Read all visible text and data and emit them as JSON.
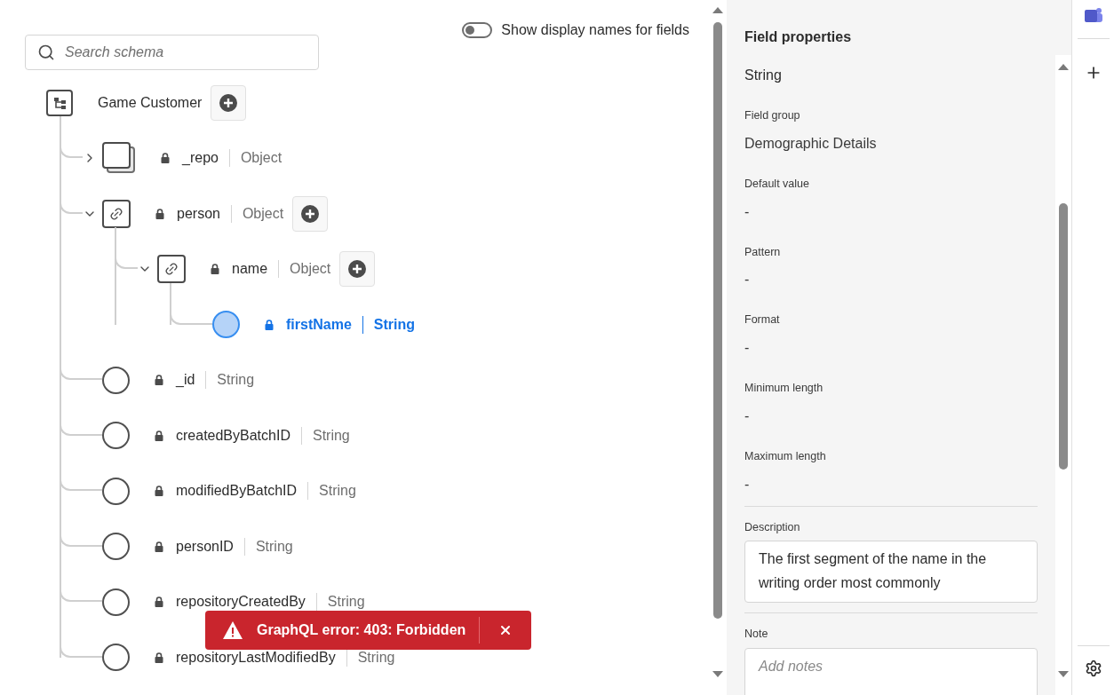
{
  "toggle": {
    "label": "Show display names for fields",
    "on": false
  },
  "search": {
    "placeholder": "Search schema"
  },
  "tree": {
    "name": "Game Customer",
    "addable": true,
    "children": [
      {
        "kind": "array",
        "name": "_repo",
        "type": "Object",
        "expanded": false,
        "selected": false,
        "addable": false
      },
      {
        "kind": "object",
        "name": "person",
        "type": "Object",
        "expanded": true,
        "selected": false,
        "addable": true,
        "children": [
          {
            "kind": "object",
            "name": "name",
            "type": "Object",
            "expanded": true,
            "selected": false,
            "addable": true,
            "children": [
              {
                "kind": "field",
                "name": "firstName",
                "type": "String",
                "selected": true,
                "addable": false
              }
            ]
          }
        ]
      },
      {
        "kind": "field",
        "name": "_id",
        "type": "String",
        "selected": false,
        "addable": false
      },
      {
        "kind": "field",
        "name": "createdByBatchID",
        "type": "String",
        "selected": false,
        "addable": false
      },
      {
        "kind": "field",
        "name": "modifiedByBatchID",
        "type": "String",
        "selected": false,
        "addable": false
      },
      {
        "kind": "field",
        "name": "personID",
        "type": "String",
        "selected": false,
        "addable": false
      },
      {
        "kind": "field",
        "name": "repositoryCreatedBy",
        "type": "String",
        "selected": false,
        "addable": false
      },
      {
        "kind": "field",
        "name": "repositoryLastModifiedBy",
        "type": "String",
        "selected": false,
        "addable": false
      }
    ]
  },
  "panel": {
    "title": "Field properties",
    "type": "String",
    "properties": [
      {
        "label": "Field group",
        "value": "Demographic Details"
      },
      {
        "label": "Default value",
        "value": "-"
      },
      {
        "label": "Pattern",
        "value": "-"
      },
      {
        "label": "Format",
        "value": "-"
      },
      {
        "label": "Minimum length",
        "value": "-"
      },
      {
        "label": "Maximum length",
        "value": "-"
      }
    ],
    "description": {
      "label": "Description",
      "value": "The first segment of the name in the writing order most commonly"
    },
    "note": {
      "label": "Note",
      "placeholder": "Add notes"
    }
  },
  "toast": {
    "message": "GraphQL error: 403: Forbidden"
  }
}
